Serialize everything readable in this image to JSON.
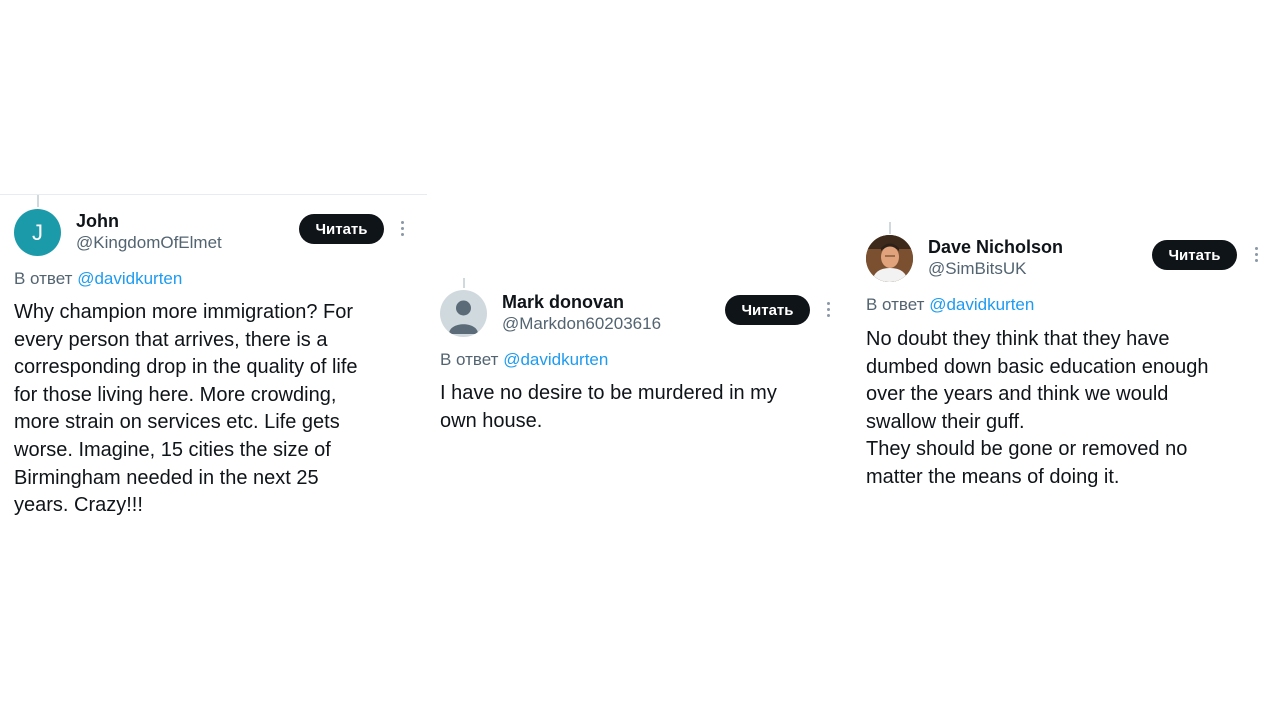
{
  "tweets": [
    {
      "author_name": "John",
      "handle": "@KingdomOfElmet",
      "avatar_letter": "J",
      "follow_label": "Читать",
      "reply_prefix": "В ответ",
      "reply_mention": "@davidkurten",
      "body": "Why champion more immigration? For\nevery person that arrives, there is a\ncorresponding drop in the quality of life\nfor those living here. More crowding,\nmore strain on services etc. Life gets\nworse. Imagine, 15 cities the size of\nBirmingham needed in the next 25\nyears. Crazy!!!"
    },
    {
      "author_name": "Mark donovan",
      "handle": "@Markdon60203616",
      "follow_label": "Читать",
      "reply_prefix": "В ответ",
      "reply_mention": "@davidkurten",
      "body": "I have no desire to be murdered in my\nown house."
    },
    {
      "author_name": "Dave Nicholson",
      "handle": "@SimBitsUK",
      "follow_label": "Читать",
      "reply_prefix": "В ответ",
      "reply_mention": "@davidkurten",
      "body": "No doubt they think that they have\ndumbed down basic education enough\nover the years and think we would\nswallow their guff.\nThey should be gone or removed no\nmatter the means of doing it."
    }
  ],
  "colors": {
    "mention": "#1d9bf0",
    "secondary_text": "#536471",
    "button_bg": "#0f1419",
    "avatar_john": "#1b9aaa"
  },
  "icons": {
    "more": "more-vertical-icon",
    "default_avatar": "default-user-icon"
  }
}
